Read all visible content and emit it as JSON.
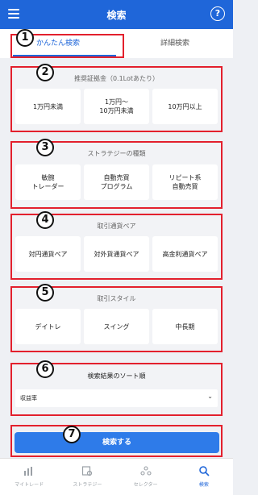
{
  "header": {
    "title": "検索",
    "help": "?"
  },
  "tabs": {
    "easy": "かんたん検索",
    "detail": "詳細検索"
  },
  "markers": [
    "1",
    "2",
    "3",
    "4",
    "5",
    "6",
    "7"
  ],
  "margin": {
    "title": "推奨証拠金（0.1Lotあたり）",
    "options": [
      "1万円未満",
      "1万円〜\n10万円未満",
      "10万円以上"
    ]
  },
  "strategy": {
    "title": "ストラテジーの種類",
    "options": [
      "敏腕\nトレーダー",
      "自動売買\nプログラム",
      "リピート系\n自動売買"
    ]
  },
  "currency": {
    "title": "取引通貨ペア",
    "options": [
      "対円通貨ペア",
      "対外貨通貨ペア",
      "高金利通貨ペア"
    ]
  },
  "style": {
    "title": "取引スタイル",
    "options": [
      "デイトレ",
      "スイング",
      "中長期"
    ]
  },
  "sort": {
    "title": "検索結果のソート順",
    "value": "収益率"
  },
  "search_button": "検索する",
  "nav": [
    {
      "label": "マイトレード",
      "icon": "chart-icon"
    },
    {
      "label": "ストラテジー",
      "icon": "strategy-icon"
    },
    {
      "label": "セレクター",
      "icon": "selector-icon"
    },
    {
      "label": "検索",
      "icon": "search-icon"
    }
  ],
  "colors": {
    "accent": "#1f66d9",
    "annotation": "#e3202d"
  }
}
